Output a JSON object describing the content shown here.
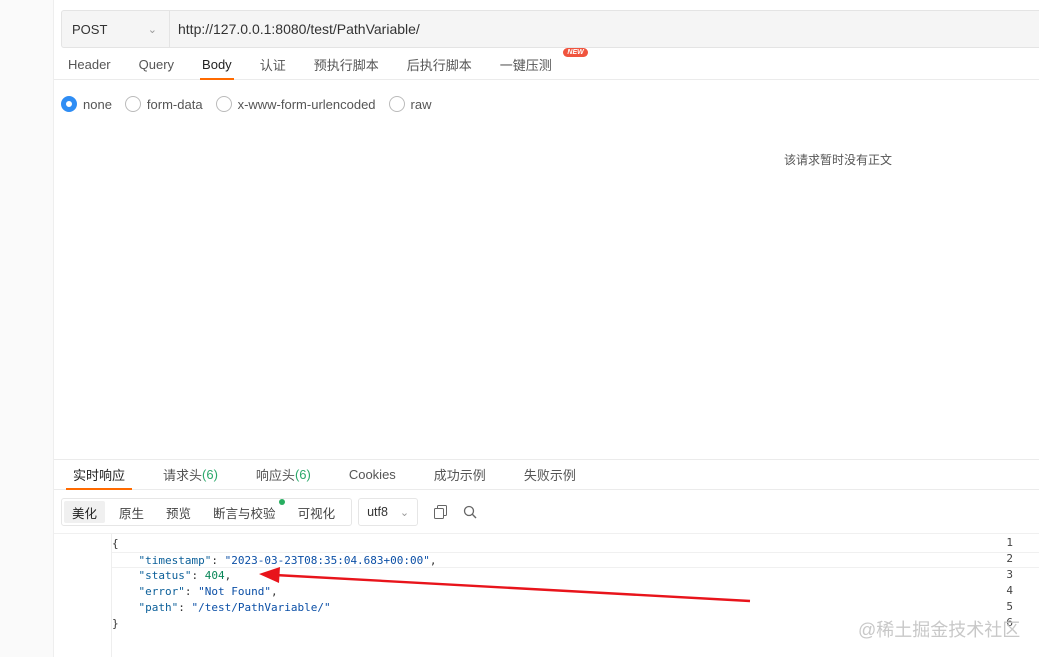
{
  "request": {
    "method": "POST",
    "url": "http://127.0.0.1:8080/test/PathVariable/"
  },
  "request_tabs": [
    {
      "label": "Header"
    },
    {
      "label": "Query"
    },
    {
      "label": "Body",
      "active": true
    },
    {
      "label": "认证"
    },
    {
      "label": "预执行脚本"
    },
    {
      "label": "后执行脚本"
    },
    {
      "label": "一键压测",
      "badge": "NEW"
    }
  ],
  "body_types": [
    {
      "label": "none",
      "checked": true
    },
    {
      "label": "form-data"
    },
    {
      "label": "x-www-form-urlencoded"
    },
    {
      "label": "raw"
    }
  ],
  "empty_body_text": "该请求暂时没有正文",
  "response_tabs": [
    {
      "label": "实时响应",
      "active": true
    },
    {
      "label": "请求头",
      "count": "(6)"
    },
    {
      "label": "响应头",
      "count": "(6)"
    },
    {
      "label": "Cookies"
    },
    {
      "label": "成功示例"
    },
    {
      "label": "失败示例"
    }
  ],
  "view_modes": [
    {
      "label": "美化",
      "active": true
    },
    {
      "label": "原生"
    },
    {
      "label": "预览"
    },
    {
      "label": "断言与校验",
      "dot": true
    },
    {
      "label": "可视化"
    }
  ],
  "encoding": "utf8",
  "code_lines": [
    {
      "num": "1",
      "text": "{"
    },
    {
      "num": "2",
      "key": "\"timestamp\"",
      "value": "\"2023-03-23T08:35:04.683+00:00\"",
      "type": "str",
      "suffix": ","
    },
    {
      "num": "3",
      "key": "\"status\"",
      "value": "404",
      "type": "num",
      "suffix": ","
    },
    {
      "num": "4",
      "key": "\"error\"",
      "value": "\"Not Found\"",
      "type": "str",
      "suffix": ","
    },
    {
      "num": "5",
      "key": "\"path\"",
      "value": "\"/test/PathVariable/\"",
      "type": "str",
      "suffix": ""
    },
    {
      "num": "6",
      "text": "}"
    }
  ],
  "watermark": "@稀土掘金技术社区",
  "colors": {
    "accent": "#ff6a00",
    "radio": "#2f8df4",
    "arrow": "#e8141b",
    "count": "#2aa86a"
  }
}
